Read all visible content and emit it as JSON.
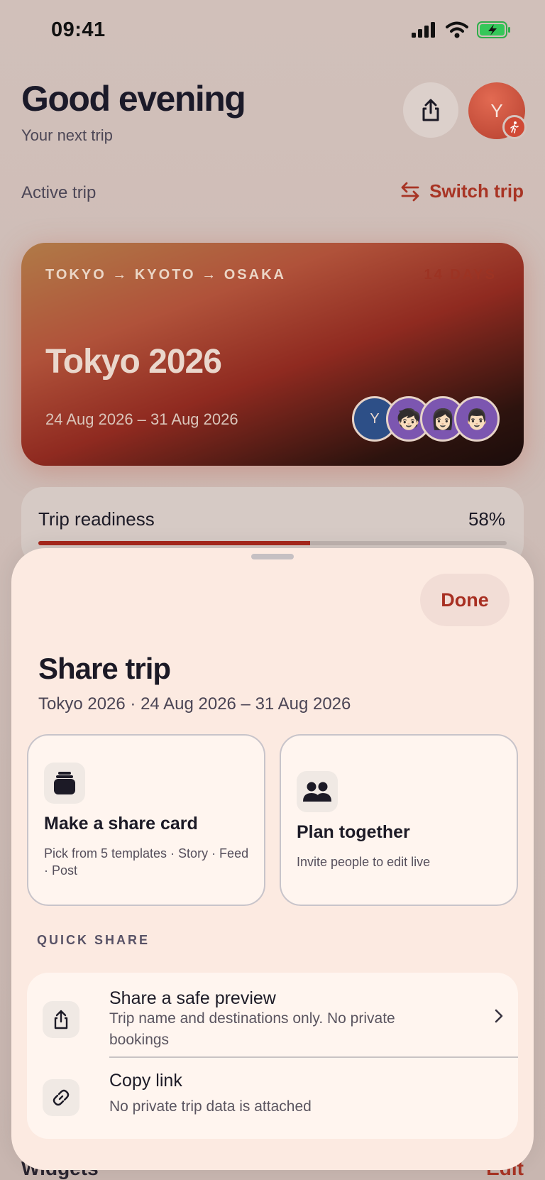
{
  "status_bar": {
    "time": "09:41"
  },
  "header": {
    "greeting": "Good evening",
    "subtitle": "Your next trip",
    "avatar_initial": "Y"
  },
  "active_trip": {
    "label": "Active trip",
    "switch_label": "Switch trip"
  },
  "trip": {
    "route": "TOKYO → KYOTO → OSAKA",
    "duration": "14 DAYS",
    "name": "Tokyo 2026",
    "dates": "24 Aug 2026 – 31 Aug 2026",
    "members": [
      "Y",
      "🧒🏻",
      "👩🏻",
      "👨🏻"
    ]
  },
  "readiness": {
    "label": "Trip readiness",
    "percent_text": "58%",
    "percent": 58
  },
  "background_section": {
    "title": "Widgets",
    "edit_label": "Edit"
  },
  "sheet": {
    "done_label": "Done",
    "title": "Share trip",
    "subtitle": "Tokyo 2026 · 24 Aug 2026 – 31 Aug 2026",
    "actions": [
      {
        "title": "Make a share card",
        "description": "Pick from 5 templates · Story · Feed · Post",
        "icon": "cards-stack-icon"
      },
      {
        "title": "Plan together",
        "description": "Invite people to edit live",
        "icon": "people-icon"
      }
    ],
    "quick_share_label": "QUICK SHARE",
    "quick_share": [
      {
        "title": "Share a safe preview",
        "description": "Trip name and destinations only. No private bookings",
        "icon": "share-icon"
      },
      {
        "title": "Copy link",
        "description": "No private trip data is attached",
        "icon": "link-icon"
      }
    ]
  },
  "colors": {
    "accent": "#a8281c",
    "sheet_bg": "#fceae1",
    "card_bg": "#fff5ef"
  }
}
